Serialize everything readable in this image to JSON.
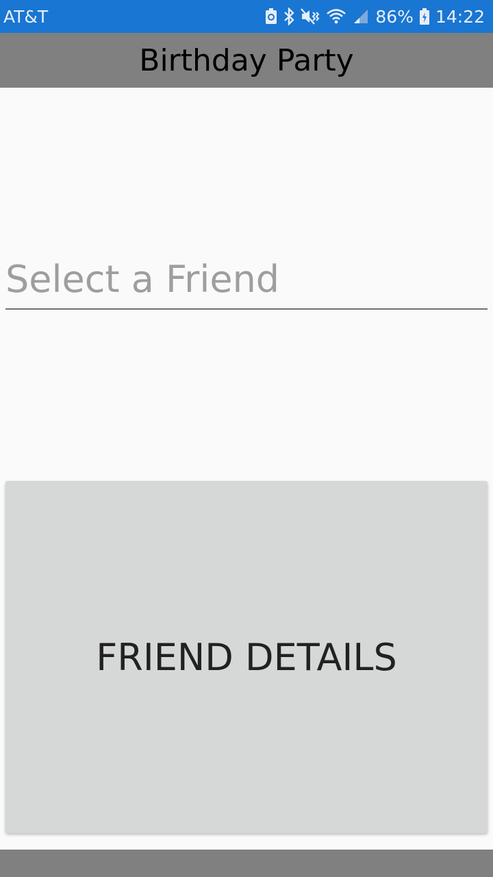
{
  "status_bar": {
    "carrier": "AT&T",
    "battery_percent": "86%",
    "time": "14:22",
    "icons": [
      "nfc-recycle-icon",
      "bluetooth-icon",
      "mute-vibrate-icon",
      "wifi-icon",
      "signal-icon",
      "battery-charging-icon"
    ]
  },
  "title_bar": {
    "title": "Birthday Party"
  },
  "picker": {
    "placeholder": "Select a Friend"
  },
  "details_button": {
    "label": "FRIEND DETAILS"
  },
  "colors": {
    "status_bar": "#1976d2",
    "title_bar": "#808080",
    "background": "#fafafa",
    "button": "#d6d7d7",
    "placeholder_text": "#9e9e9e"
  }
}
